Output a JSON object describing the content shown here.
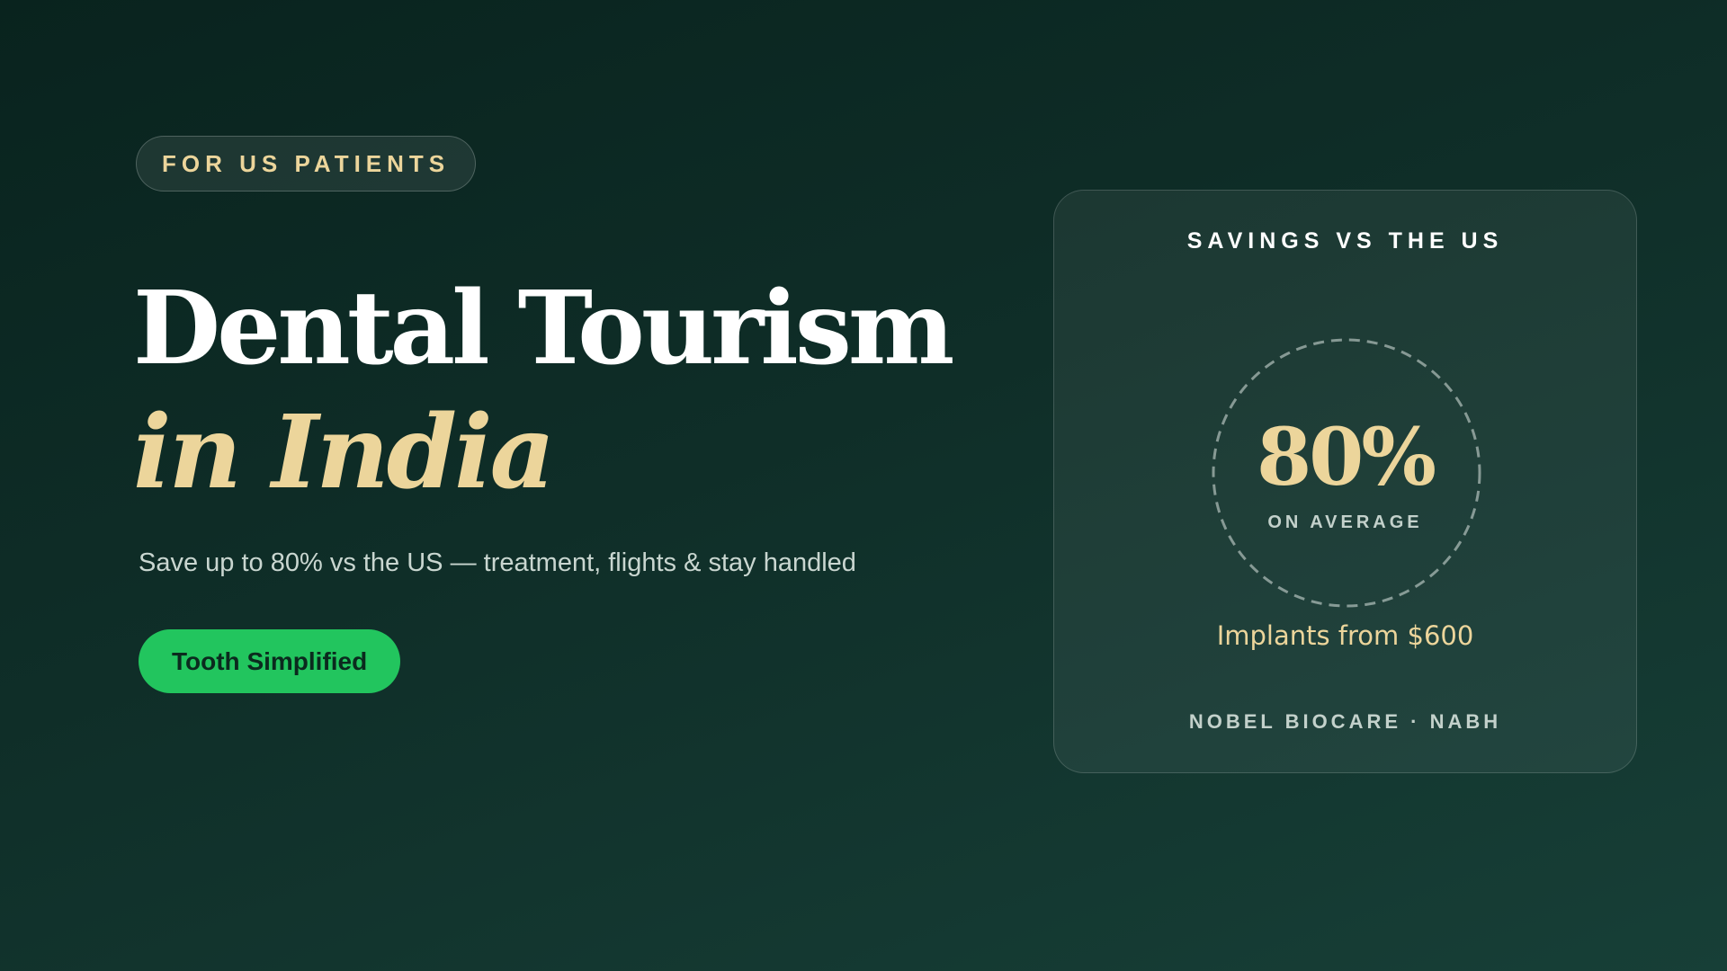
{
  "hero": {
    "badge": "FOR US PATIENTS",
    "title_line1": "Dental Tourism",
    "title_line2": "in India",
    "subtitle": "Save up to 80% vs the US — treatment, flights & stay handled",
    "cta_label": "Tooth Simplified"
  },
  "card": {
    "heading": "SAVINGS VS THE US",
    "stat_value": "80%",
    "stat_caption": "ON AVERAGE",
    "price_line": "Implants from $600",
    "badges": "NOBEL BIOCARE · NABH"
  },
  "colors": {
    "accent_gold": "#ecd59b",
    "cta_green": "#22c55e",
    "background_dark": "#0c2622",
    "background_light": "#173f37"
  }
}
